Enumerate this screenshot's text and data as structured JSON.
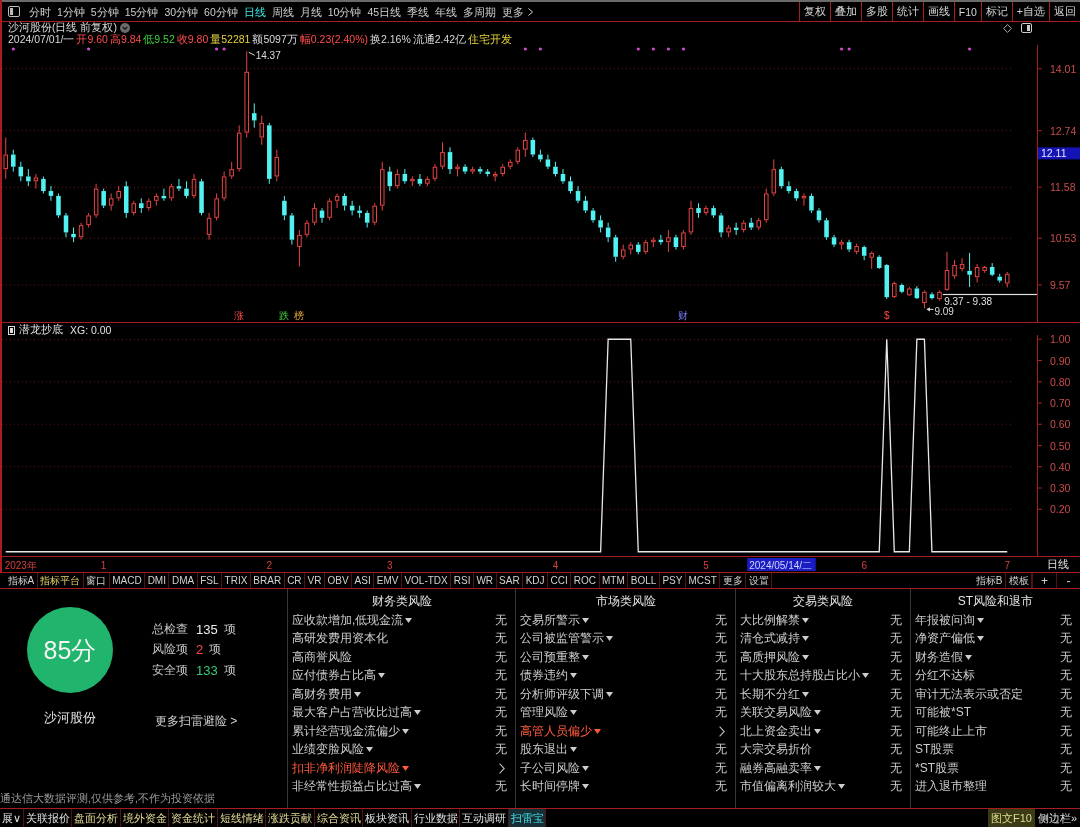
{
  "toolbar": {
    "periods": [
      {
        "label": "分时",
        "kind": "period",
        "selected": false
      },
      {
        "label": "1分钟",
        "kind": "period",
        "selected": false
      },
      {
        "label": "5分钟",
        "kind": "period",
        "selected": false
      },
      {
        "label": "15分钟",
        "kind": "period",
        "selected": false
      },
      {
        "label": "30分钟",
        "kind": "period",
        "selected": false
      },
      {
        "label": "60分钟",
        "kind": "period",
        "selected": false
      },
      {
        "label": "日线",
        "kind": "period",
        "selected": true
      },
      {
        "label": "周线",
        "kind": "period",
        "selected": false
      },
      {
        "label": "月线",
        "kind": "period",
        "selected": false
      },
      {
        "label": "10分钟",
        "kind": "period",
        "selected": false
      },
      {
        "label": "45日线",
        "kind": "period",
        "selected": false
      },
      {
        "label": "季线",
        "kind": "period",
        "selected": false
      },
      {
        "label": "年线",
        "kind": "period",
        "selected": false
      },
      {
        "label": "多周期",
        "kind": "period",
        "selected": false
      },
      {
        "label": "更多",
        "kind": "menu",
        "selected": false
      }
    ],
    "actions": [
      "复权",
      "叠加",
      "多股",
      "统计",
      "画线",
      "F10",
      "标记",
      "+自选",
      "返回"
    ]
  },
  "price_pane": {
    "title": "沙河股份(日线 前复权)",
    "quote": [
      {
        "text": "2024/07/01/一",
        "kind": "date"
      },
      {
        "text": "开9.60",
        "kind": "up"
      },
      {
        "text": "高9.84",
        "kind": "up"
      },
      {
        "text": "低9.52",
        "kind": "down"
      },
      {
        "text": "收9.80",
        "kind": "up"
      },
      {
        "text": "量52281",
        "kind": "volume"
      },
      {
        "text": "额5097万",
        "kind": "plain"
      },
      {
        "text": "幅0.23(2.40%)",
        "kind": "up"
      },
      {
        "text": "换2.16%",
        "kind": "plain"
      },
      {
        "text": "流通2.42亿",
        "kind": "plain"
      },
      {
        "text": "住宅开发",
        "kind": "sector"
      }
    ],
    "chart_data": [
      {
        "type": "candlestick",
        "ylim": [
          8.81,
          14.5
        ],
        "yticks": [
          9.57,
          10.53,
          11.58,
          12.74,
          14.01
        ],
        "grid": true,
        "bands": [
          {
            "axis": "y",
            "from": 9.37,
            "to": 9.38,
            "label": "9.37 - 9.38",
            "color": "#e0e0e0"
          }
        ],
        "ohlc": [
          [
            11.95,
            12.6,
            11.75,
            12.25
          ],
          [
            12.25,
            12.35,
            11.9,
            12.0
          ],
          [
            12.0,
            12.1,
            11.7,
            11.8
          ],
          [
            11.8,
            11.95,
            11.6,
            11.7
          ],
          [
            11.7,
            11.85,
            11.55,
            11.78
          ],
          [
            11.75,
            11.8,
            11.45,
            11.5
          ],
          [
            11.5,
            11.6,
            11.3,
            11.4
          ],
          [
            11.4,
            11.45,
            10.95,
            11.0
          ],
          [
            11.0,
            11.05,
            10.55,
            10.65
          ],
          [
            10.62,
            10.75,
            10.45,
            10.55
          ],
          [
            10.55,
            10.85,
            10.5,
            10.8
          ],
          [
            10.8,
            11.05,
            10.75,
            11.0
          ],
          [
            11.0,
            11.65,
            10.95,
            11.55
          ],
          [
            11.5,
            11.55,
            11.15,
            11.2
          ],
          [
            11.2,
            11.45,
            11.1,
            11.35
          ],
          [
            11.35,
            11.6,
            11.3,
            11.5
          ],
          [
            11.6,
            11.7,
            10.95,
            11.05
          ],
          [
            11.05,
            11.3,
            11.0,
            11.25
          ],
          [
            11.25,
            11.35,
            11.05,
            11.15
          ],
          [
            11.15,
            11.35,
            11.1,
            11.3
          ],
          [
            11.3,
            11.45,
            11.2,
            11.4
          ],
          [
            11.4,
            11.55,
            11.3,
            11.35
          ],
          [
            11.35,
            11.65,
            11.3,
            11.6
          ],
          [
            11.6,
            11.75,
            11.5,
            11.55
          ],
          [
            11.55,
            11.7,
            11.35,
            11.4
          ],
          [
            11.4,
            11.85,
            11.35,
            11.75
          ],
          [
            11.7,
            11.75,
            11.0,
            11.05
          ],
          [
            10.6,
            11.05,
            10.5,
            10.95
          ],
          [
            10.95,
            11.45,
            10.9,
            11.35
          ],
          [
            11.35,
            11.9,
            11.3,
            11.8
          ],
          [
            11.8,
            12.1,
            11.75,
            11.95
          ],
          [
            11.95,
            12.85,
            11.9,
            12.7
          ],
          [
            12.7,
            14.37,
            12.6,
            13.95
          ],
          [
            13.1,
            13.3,
            12.8,
            12.95
          ],
          [
            12.6,
            13.05,
            12.45,
            12.9
          ],
          [
            12.85,
            12.9,
            11.65,
            11.75
          ],
          [
            11.8,
            12.35,
            11.7,
            12.2
          ],
          [
            11.3,
            11.4,
            10.9,
            11.0
          ],
          [
            11.0,
            11.05,
            10.4,
            10.5
          ],
          [
            10.35,
            10.7,
            9.95,
            10.6
          ],
          [
            10.6,
            10.9,
            10.55,
            10.85
          ],
          [
            10.85,
            11.25,
            10.8,
            11.15
          ],
          [
            11.1,
            11.15,
            10.85,
            10.95
          ],
          [
            10.95,
            11.35,
            10.9,
            11.3
          ],
          [
            11.3,
            11.45,
            11.15,
            11.4
          ],
          [
            11.4,
            11.45,
            11.1,
            11.2
          ],
          [
            11.2,
            11.3,
            11.0,
            11.1
          ],
          [
            11.1,
            11.2,
            10.95,
            11.05
          ],
          [
            11.05,
            11.1,
            10.75,
            10.85
          ],
          [
            10.85,
            11.25,
            10.8,
            11.2
          ],
          [
            11.2,
            12.1,
            11.1,
            11.95
          ],
          [
            11.9,
            12.0,
            11.5,
            11.6
          ],
          [
            11.6,
            11.95,
            11.55,
            11.85
          ],
          [
            11.85,
            11.95,
            11.65,
            11.7
          ],
          [
            11.7,
            11.8,
            11.6,
            11.75
          ],
          [
            11.75,
            11.85,
            11.6,
            11.65
          ],
          [
            11.65,
            11.8,
            11.6,
            11.75
          ],
          [
            11.75,
            12.05,
            11.7,
            12.0
          ],
          [
            12.0,
            12.5,
            11.95,
            12.3
          ],
          [
            12.3,
            12.4,
            11.85,
            11.95
          ],
          [
            11.95,
            12.05,
            11.8,
            12.0
          ],
          [
            12.0,
            12.05,
            11.85,
            11.9
          ],
          [
            11.9,
            12.0,
            11.85,
            11.95
          ],
          [
            11.95,
            12.0,
            11.85,
            11.9
          ],
          [
            11.9,
            11.95,
            11.8,
            11.85
          ],
          [
            11.8,
            11.9,
            11.7,
            11.85
          ],
          [
            11.85,
            12.05,
            11.8,
            12.0
          ],
          [
            12.0,
            12.15,
            11.95,
            12.1
          ],
          [
            12.1,
            12.4,
            12.05,
            12.35
          ],
          [
            12.35,
            12.7,
            12.2,
            12.55
          ],
          [
            12.55,
            12.6,
            12.2,
            12.25
          ],
          [
            12.25,
            12.35,
            12.1,
            12.15
          ],
          [
            12.15,
            12.25,
            11.95,
            12.0
          ],
          [
            12.0,
            12.1,
            11.8,
            11.85
          ],
          [
            11.85,
            11.95,
            11.65,
            11.7
          ],
          [
            11.7,
            11.8,
            11.45,
            11.5
          ],
          [
            11.5,
            11.6,
            11.25,
            11.3
          ],
          [
            11.3,
            11.4,
            11.05,
            11.1
          ],
          [
            11.1,
            11.15,
            10.85,
            10.9
          ],
          [
            10.9,
            11.0,
            10.65,
            10.75
          ],
          [
            10.75,
            10.85,
            10.45,
            10.55
          ],
          [
            10.55,
            10.6,
            10.05,
            10.15
          ],
          [
            10.15,
            10.4,
            10.1,
            10.3
          ],
          [
            10.3,
            10.45,
            10.2,
            10.4
          ],
          [
            10.4,
            10.45,
            10.2,
            10.25
          ],
          [
            10.25,
            10.5,
            10.2,
            10.45
          ],
          [
            10.45,
            10.55,
            10.35,
            10.5
          ],
          [
            10.5,
            10.6,
            10.4,
            10.45
          ],
          [
            10.45,
            10.7,
            10.25,
            10.55
          ],
          [
            10.55,
            10.6,
            10.3,
            10.35
          ],
          [
            10.35,
            10.7,
            10.3,
            10.65
          ],
          [
            10.65,
            11.3,
            10.6,
            11.15
          ],
          [
            11.15,
            11.25,
            10.95,
            11.05
          ],
          [
            11.05,
            11.2,
            11.0,
            11.15
          ],
          [
            11.15,
            11.2,
            10.95,
            11.0
          ],
          [
            11.0,
            11.05,
            10.55,
            10.65
          ],
          [
            10.65,
            10.8,
            10.55,
            10.75
          ],
          [
            10.75,
            10.85,
            10.6,
            10.7
          ],
          [
            10.7,
            10.9,
            10.65,
            10.85
          ],
          [
            10.85,
            10.95,
            10.7,
            10.75
          ],
          [
            10.75,
            10.95,
            10.7,
            10.9
          ],
          [
            10.9,
            11.55,
            10.85,
            11.45
          ],
          [
            11.45,
            12.15,
            11.4,
            11.95
          ],
          [
            11.95,
            12.0,
            11.55,
            11.6
          ],
          [
            11.6,
            11.7,
            11.45,
            11.5
          ],
          [
            11.5,
            11.55,
            11.3,
            11.35
          ],
          [
            11.35,
            11.45,
            11.2,
            11.4
          ],
          [
            11.4,
            11.45,
            11.05,
            11.1
          ],
          [
            11.1,
            11.15,
            10.85,
            10.9
          ],
          [
            10.9,
            10.95,
            10.5,
            10.55
          ],
          [
            10.55,
            10.6,
            10.35,
            10.4
          ],
          [
            10.4,
            10.5,
            10.3,
            10.45
          ],
          [
            10.45,
            10.5,
            10.25,
            10.3
          ],
          [
            10.25,
            10.42,
            10.2,
            10.37
          ],
          [
            10.35,
            10.38,
            10.08,
            10.17
          ],
          [
            10.13,
            10.26,
            9.9,
            10.23
          ],
          [
            10.15,
            10.18,
            9.9,
            9.92
          ],
          [
            9.98,
            10.0,
            9.28,
            9.32
          ],
          [
            9.32,
            9.64,
            9.3,
            9.61
          ],
          [
            9.57,
            9.6,
            9.4,
            9.43
          ],
          [
            9.36,
            9.53,
            9.34,
            9.5
          ],
          [
            9.5,
            9.55,
            9.28,
            9.3
          ],
          [
            9.2,
            9.46,
            9.09,
            9.43
          ],
          [
            9.38,
            9.42,
            9.27,
            9.3
          ],
          [
            9.28,
            9.46,
            9.25,
            9.43
          ],
          [
            9.47,
            10.25,
            9.45,
            9.88
          ],
          [
            9.75,
            10.08,
            9.7,
            9.98
          ],
          [
            9.9,
            10.12,
            9.85,
            10.0
          ],
          [
            9.86,
            10.23,
            9.53,
            9.78
          ],
          [
            9.73,
            10.0,
            9.62,
            9.94
          ],
          [
            9.86,
            9.96,
            9.82,
            9.94
          ],
          [
            9.94,
            10.02,
            9.75,
            9.78
          ],
          [
            9.74,
            9.8,
            9.62,
            9.66
          ],
          [
            9.6,
            9.84,
            9.52,
            9.8
          ]
        ],
        "annotations": [
          "14.37",
          "9.09",
          "12.11",
          "涨",
          "跌",
          "榜",
          "财",
          "$"
        ]
      }
    ]
  },
  "indicator_pane": {
    "name": "潜龙抄底",
    "reading": "XG: 0.00",
    "period_label": "日线",
    "chart_data": [
      {
        "type": "line",
        "color": "#e8e8e8",
        "ylim": [
          -0.02,
          1.02
        ],
        "grid": true,
        "yticks": [
          {
            "value": 0.2,
            "label": "0.20"
          },
          {
            "value": 0.3,
            "label": "0.30"
          },
          {
            "value": 0.4,
            "label": "0.40"
          },
          {
            "value": 0.5,
            "label": "0.50"
          },
          {
            "value": 0.6,
            "label": "0.60"
          },
          {
            "value": 0.7,
            "label": "0.70"
          },
          {
            "value": 0.8,
            "label": "0.80"
          },
          {
            "value": 0.9,
            "label": "0.90"
          },
          {
            "value": 1.0,
            "label": "1.00"
          }
        ],
        "categories": [
          null,
          null,
          "2023年",
          null,
          null,
          null,
          null,
          null,
          null,
          null,
          null,
          null,
          null,
          "1",
          null,
          null,
          null,
          null,
          null,
          null,
          null,
          null,
          null,
          null,
          null,
          null,
          null,
          null,
          null,
          null,
          null,
          null,
          null,
          null,
          null,
          "2",
          null,
          null,
          null,
          null,
          null,
          null,
          null,
          null,
          null,
          null,
          null,
          null,
          null,
          null,
          null,
          "3",
          null,
          null,
          null,
          null,
          null,
          null,
          null,
          null,
          null,
          null,
          null,
          null,
          null,
          null,
          null,
          null,
          null,
          null,
          null,
          null,
          null,
          "4",
          null,
          null,
          null,
          null,
          null,
          null,
          null,
          null,
          null,
          null,
          null,
          null,
          null,
          null,
          null,
          null,
          null,
          null,
          null,
          "5",
          null,
          null,
          null,
          null,
          null,
          null,
          null,
          null,
          null,
          null,
          null,
          null,
          null,
          null,
          null,
          null,
          null,
          null,
          null,
          null,
          "6",
          null,
          null,
          null,
          null,
          null,
          null,
          null,
          null,
          null,
          null,
          null,
          null,
          null,
          null,
          null,
          null,
          null,
          null,
          "7"
        ],
        "values": [
          0,
          0,
          0,
          0,
          0,
          0,
          0,
          0,
          0,
          0,
          0,
          0,
          0,
          0,
          0,
          0,
          0,
          0,
          0,
          0,
          0,
          0,
          0,
          0,
          0,
          0,
          0,
          0,
          0,
          0,
          0,
          0,
          0,
          0,
          0,
          0,
          0,
          0,
          0,
          0,
          0,
          0,
          0,
          0,
          0,
          0,
          0,
          0,
          0,
          0,
          0,
          0,
          0,
          0,
          0,
          0,
          0,
          0,
          0,
          0,
          0,
          0,
          0,
          0,
          0,
          0,
          0,
          0,
          0,
          0,
          0,
          0,
          0,
          0,
          0,
          0,
          0,
          0,
          0,
          0,
          1,
          1,
          1,
          1,
          0,
          0,
          0,
          0,
          0,
          0,
          0,
          0,
          0,
          0,
          0,
          0,
          0,
          0,
          0,
          0,
          0,
          0,
          0,
          0,
          0,
          0,
          0,
          0,
          0,
          0,
          0,
          0,
          0,
          0,
          0,
          0,
          0,
          1,
          0,
          0,
          0,
          1,
          1,
          0,
          0,
          0,
          0,
          0,
          0,
          0,
          0,
          0,
          0,
          0
        ],
        "annotations": [
          "2024/05/14/二"
        ]
      }
    ]
  },
  "indicator_tabs": {
    "items": [
      {
        "label": "指标A",
        "highlighted": false
      },
      {
        "label": "指标平台",
        "highlighted": true
      },
      {
        "label": "窗口",
        "highlighted": false
      },
      {
        "label": "MACD",
        "highlighted": false
      },
      {
        "label": "DMI",
        "highlighted": false
      },
      {
        "label": "DMA",
        "highlighted": false
      },
      {
        "label": "FSL",
        "highlighted": false
      },
      {
        "label": "TRIX",
        "highlighted": false
      },
      {
        "label": "BRAR",
        "highlighted": false
      },
      {
        "label": "CR",
        "highlighted": false
      },
      {
        "label": "VR",
        "highlighted": false
      },
      {
        "label": "OBV",
        "highlighted": false
      },
      {
        "label": "ASI",
        "highlighted": false
      },
      {
        "label": "EMV",
        "highlighted": false
      },
      {
        "label": "VOL-TDX",
        "highlighted": false
      },
      {
        "label": "RSI",
        "highlighted": false
      },
      {
        "label": "WR",
        "highlighted": false
      },
      {
        "label": "SAR",
        "highlighted": false
      },
      {
        "label": "KDJ",
        "highlighted": false
      },
      {
        "label": "CCI",
        "highlighted": false
      },
      {
        "label": "ROC",
        "highlighted": false
      },
      {
        "label": "MTM",
        "highlighted": false
      },
      {
        "label": "BOLL",
        "highlighted": false
      },
      {
        "label": "PSY",
        "highlighted": false
      },
      {
        "label": "MCST",
        "highlighted": false
      },
      {
        "label": "更多",
        "highlighted": false
      },
      {
        "label": "设置",
        "highlighted": false
      }
    ],
    "right_items": [
      "指标B",
      "模板"
    ],
    "zoom_buttons": [
      "+",
      "-"
    ]
  },
  "risk_panel": {
    "score": "85分",
    "stock": "沙河股份",
    "stats": [
      {
        "label": "总检查",
        "count": "135",
        "unit": "项",
        "kind": "total"
      },
      {
        "label": "风险项",
        "count": "2",
        "unit": "项",
        "kind": "risk"
      },
      {
        "label": "安全项",
        "count": "133",
        "unit": "项",
        "kind": "safe"
      }
    ],
    "more_link": "更多扫雷避险 >",
    "disclaimer": "通达信大数据评测,仅供参考,不作为投资依据",
    "columns": [
      {
        "title": "财务类风险",
        "rows": [
          {
            "label": "应收款增加,低现金流",
            "expandable": true,
            "risk": false,
            "value": "无"
          },
          {
            "label": "高研发费用资本化",
            "expandable": false,
            "risk": false,
            "value": "无"
          },
          {
            "label": "高商誉风险",
            "expandable": false,
            "risk": false,
            "value": "无"
          },
          {
            "label": "应付债券占比高",
            "expandable": true,
            "risk": false,
            "value": "无"
          },
          {
            "label": "高财务费用",
            "expandable": true,
            "risk": false,
            "value": "无"
          },
          {
            "label": "最大客户占营收比过高",
            "expandable": true,
            "risk": false,
            "value": "无"
          },
          {
            "label": "累计经营现金流偏少",
            "expandable": true,
            "risk": false,
            "value": "无"
          },
          {
            "label": "业绩变脸风险",
            "expandable": true,
            "risk": false,
            "value": "无"
          },
          {
            "label": "扣非净利润陡降风险",
            "expandable": true,
            "risk": true
          },
          {
            "label": "非经常性损益占比过高",
            "expandable": true,
            "risk": false,
            "value": "无"
          }
        ]
      },
      {
        "title": "市场类风险",
        "rows": [
          {
            "label": "交易所警示",
            "expandable": true,
            "risk": false,
            "value": "无"
          },
          {
            "label": "公司被监管警示",
            "expandable": true,
            "risk": false,
            "value": "无"
          },
          {
            "label": "公司预重整",
            "expandable": true,
            "risk": false,
            "value": "无"
          },
          {
            "label": "债券违约",
            "expandable": true,
            "risk": false,
            "value": "无"
          },
          {
            "label": "分析师评级下调",
            "expandable": true,
            "risk": false,
            "value": "无"
          },
          {
            "label": "管理风险",
            "expandable": true,
            "risk": false,
            "value": "无"
          },
          {
            "label": "高管人员偏少",
            "expandable": true,
            "risk": true
          },
          {
            "label": "股东退出",
            "expandable": true,
            "risk": false,
            "value": "无"
          },
          {
            "label": "子公司风险",
            "expandable": true,
            "risk": false,
            "value": "无"
          },
          {
            "label": "长时间停牌",
            "expandable": true,
            "risk": false,
            "value": "无"
          }
        ]
      },
      {
        "title": "交易类风险",
        "rows": [
          {
            "label": "大比例解禁",
            "expandable": true,
            "risk": false,
            "value": "无"
          },
          {
            "label": "清仓式减持",
            "expandable": true,
            "risk": false,
            "value": "无"
          },
          {
            "label": "高质押风险",
            "expandable": true,
            "risk": false,
            "value": "无"
          },
          {
            "label": "十大股东总持股占比小",
            "expandable": true,
            "risk": false,
            "value": "无"
          },
          {
            "label": "长期不分红",
            "expandable": true,
            "risk": false,
            "value": "无"
          },
          {
            "label": "关联交易风险",
            "expandable": true,
            "risk": false,
            "value": "无"
          },
          {
            "label": "北上资金卖出",
            "expandable": true,
            "risk": false,
            "value": "无"
          },
          {
            "label": "大宗交易折价",
            "expandable": false,
            "risk": false,
            "value": "无"
          },
          {
            "label": "融券高融卖率",
            "expandable": true,
            "risk": false,
            "value": "无"
          },
          {
            "label": "市值偏离利润较大",
            "expandable": true,
            "risk": false,
            "value": "无"
          }
        ]
      },
      {
        "title": "ST风险和退市",
        "rows": [
          {
            "label": "年报被问询",
            "expandable": true,
            "risk": false,
            "value": "无"
          },
          {
            "label": "净资产偏低",
            "expandable": true,
            "risk": false,
            "value": "无"
          },
          {
            "label": "财务造假",
            "expandable": true,
            "risk": false,
            "value": "无"
          },
          {
            "label": "分红不达标",
            "expandable": false,
            "risk": false,
            "value": "无"
          },
          {
            "label": "审计无法表示或否定",
            "expandable": false,
            "risk": false,
            "value": "无"
          },
          {
            "label": "可能被*ST",
            "expandable": false,
            "risk": false,
            "value": "无"
          },
          {
            "label": "可能终止上市",
            "expandable": false,
            "risk": false,
            "value": "无"
          },
          {
            "label": "ST股票",
            "expandable": false,
            "risk": false,
            "value": "无"
          },
          {
            "label": "*ST股票",
            "expandable": false,
            "risk": false,
            "value": "无"
          },
          {
            "label": "进入退市整理",
            "expandable": false,
            "risk": false,
            "value": "无"
          }
        ]
      }
    ]
  },
  "bottom_bar": {
    "tabs": [
      {
        "label": "展∨",
        "kind": "plain",
        "selected": false
      },
      {
        "label": "关联报价",
        "kind": "plain",
        "selected": false
      },
      {
        "label": "盘面分析",
        "kind": "accent",
        "selected": false
      },
      {
        "label": "境外资金",
        "kind": "accent",
        "selected": false
      },
      {
        "label": "资金统计",
        "kind": "accent",
        "selected": false
      },
      {
        "label": "短线情绪",
        "kind": "accent",
        "selected": false
      },
      {
        "label": "涨跌贡献",
        "kind": "accent",
        "selected": false
      },
      {
        "label": "综合资讯",
        "kind": "accent",
        "selected": false
      },
      {
        "label": "板块资讯",
        "kind": "plain",
        "selected": false
      },
      {
        "label": "行业数据",
        "kind": "plain",
        "selected": false
      },
      {
        "label": "互动调研",
        "kind": "plain",
        "selected": false
      },
      {
        "label": "扫雷宝",
        "kind": "active",
        "selected": true
      }
    ],
    "side_buttons": [
      {
        "label": "图文F10",
        "kind": "f10"
      },
      {
        "label": "侧边栏»",
        "kind": "sidebar"
      }
    ]
  }
}
